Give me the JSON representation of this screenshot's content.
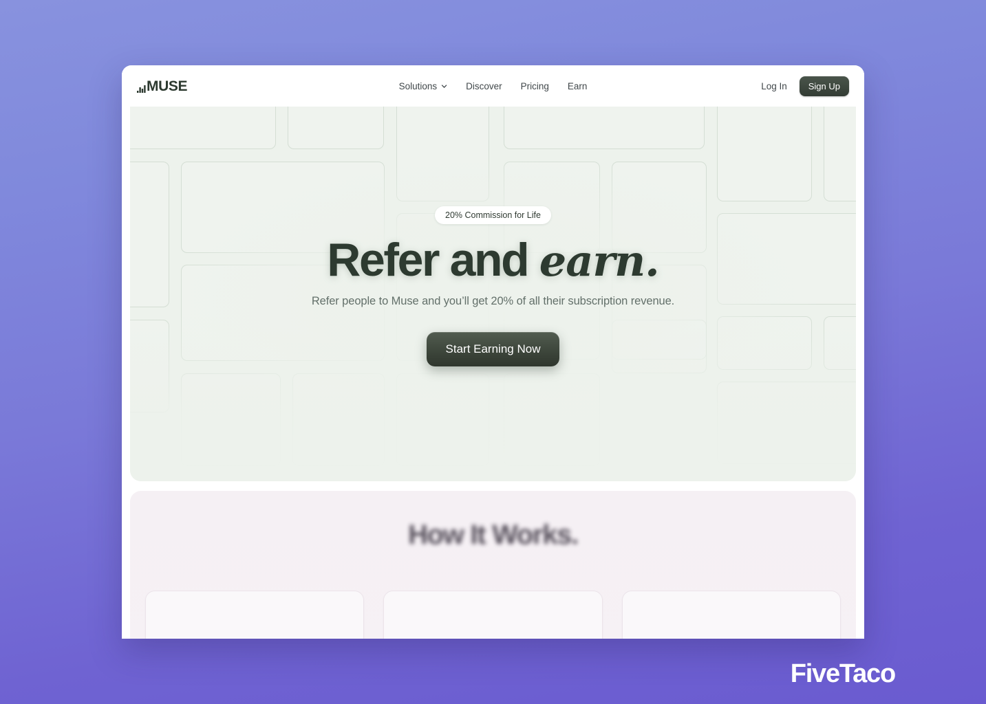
{
  "background": {
    "gradient_from": "#8892de",
    "gradient_to": "#6a5bd0"
  },
  "navbar": {
    "logo_text": "MUSE",
    "logo_icon": "bar-chart-mark-icon",
    "links": [
      {
        "label": "Solutions",
        "has_dropdown": true,
        "icon": "chevron-down-icon"
      },
      {
        "label": "Discover",
        "has_dropdown": false
      },
      {
        "label": "Pricing",
        "has_dropdown": false
      },
      {
        "label": "Earn",
        "has_dropdown": false
      }
    ],
    "login_label": "Log In",
    "signup_label": "Sign Up",
    "signup_color": "#333c34"
  },
  "hero": {
    "background_color": "#edf2ec",
    "badge": "20% Commission for Life",
    "headline_plain": "Refer and ",
    "headline_script": "earn.",
    "subheadline": "Refer people to Muse and you’ll get 20% of all their subscription revenue.",
    "cta_label": "Start Earning Now",
    "cta_color": "#3a4339",
    "heading_color": "#2d3a30"
  },
  "how_it_works": {
    "background_color": "#f5f0f4",
    "title": "How It Works.",
    "title_blurred": true,
    "cards": [
      {
        "id": "card-1",
        "decoration": "none"
      },
      {
        "id": "card-2",
        "decoration": "rounded-pill"
      },
      {
        "id": "card-3",
        "decoration": "chip",
        "chip_icon": "app-square-icon",
        "chip_text": ""
      }
    ]
  },
  "watermark": {
    "text": "FiveTaco",
    "color": "#ffffff"
  }
}
